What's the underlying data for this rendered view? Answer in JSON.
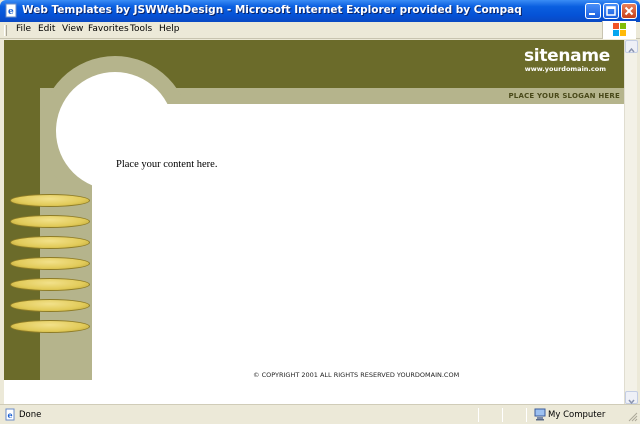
{
  "window": {
    "title": "Web Templates by JSWWebDesign - Microsoft Internet Explorer provided by Compaq"
  },
  "menu": {
    "items": [
      "File",
      "Edit",
      "View",
      "Favorites",
      "Tools",
      "Help"
    ]
  },
  "page": {
    "sitename": "sitename",
    "domain": "www.yourdomain.com",
    "slogan": "PLACE YOUR SLOGAN HERE",
    "content": "Place your content here.",
    "copyright": "© COPYRIGHT 2001 ALL RIGHTS RESERVED YOURDOMAIN.COM",
    "nav_buttons": [
      "",
      "",
      "",
      "",
      "",
      "",
      ""
    ]
  },
  "status": {
    "text": "Done",
    "zone": "My Computer"
  },
  "colors": {
    "olive": "#6b6b2a",
    "beige": "#b5b48c",
    "gold": "#e2cb5a",
    "titlebar": "#0a5fe0"
  },
  "icons": {
    "title": "ie-page-icon",
    "minimize": "minimize-icon",
    "maximize": "maximize-icon",
    "close": "close-icon",
    "status": "page-done-icon",
    "zone": "my-computer-icon"
  }
}
